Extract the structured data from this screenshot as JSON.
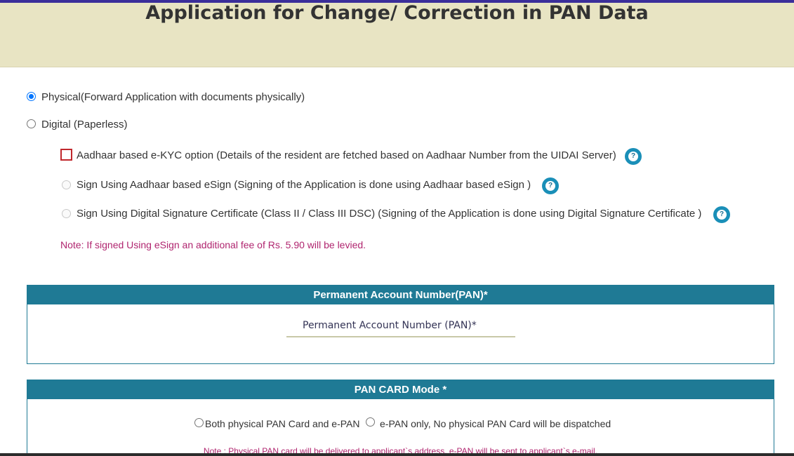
{
  "header": {
    "title": "Application for Change/ Correction in PAN Data"
  },
  "submission_mode": {
    "options": [
      {
        "label": "Physical(Forward Application with documents physically)",
        "selected": true
      },
      {
        "label": "Digital (Paperless)",
        "selected": false
      }
    ]
  },
  "digital_options": {
    "ekyc": {
      "label": "Aadhaar based e-KYC option (Details of the resident are fetched based on Aadhaar Number from the UIDAI Server)",
      "checked": false
    },
    "esign": {
      "label": "Sign Using Aadhaar based eSign (Signing of the Application is done using Aadhaar based eSign )"
    },
    "dsc": {
      "label": "Sign Using Digital Signature Certificate (Class II / Class III DSC) (Signing of the Application is done using Digital Signature Certificate )"
    },
    "help_glyph": "?"
  },
  "esign_note": "Note: If signed Using eSign an additional fee of Rs. 5.90 will be levied.",
  "pan_panel": {
    "heading": "Permanent Account Number(PAN)*",
    "input_placeholder": "Permanent Account Number (PAN)*"
  },
  "card_mode_panel": {
    "heading": "PAN CARD Mode *",
    "options": [
      {
        "label": "Both physical PAN Card and e-PAN"
      },
      {
        "label": "e-PAN only, No physical PAN Card will be dispatched"
      }
    ],
    "note": "Note : Physical PAN card will be delivered to applicant`s address. e-PAN will be sent to applicant`s e-mail."
  },
  "colors": {
    "header_band": "#e8e4c3",
    "panel_accent": "#1f7a95",
    "note_text": "#b0256f",
    "help_icon": "#1a8fb8",
    "checkbox_border": "#c0282d"
  }
}
